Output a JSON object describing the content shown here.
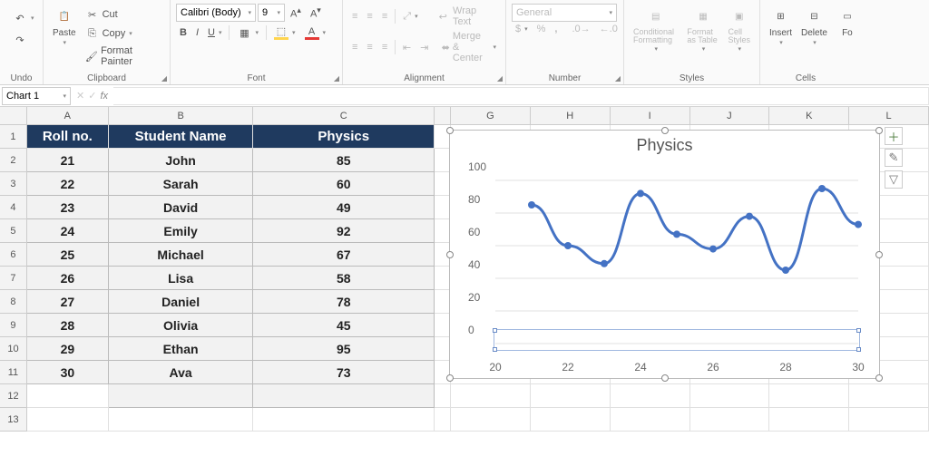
{
  "ribbon": {
    "undo": {
      "label": "Undo"
    },
    "clipboard": {
      "label": "Clipboard",
      "paste": "Paste",
      "cut": "Cut",
      "copy": "Copy",
      "format_painter": "Format Painter"
    },
    "font": {
      "label": "Font",
      "name": "Calibri (Body)",
      "size": "9"
    },
    "alignment": {
      "label": "Alignment",
      "wrap": "Wrap Text",
      "merge": "Merge & Center"
    },
    "number": {
      "label": "Number",
      "format": "General"
    },
    "styles": {
      "label": "Styles",
      "cond": "Conditional Formatting",
      "table": "Format as Table",
      "cell": "Cell Styles"
    },
    "cells": {
      "label": "Cells",
      "insert": "Insert",
      "delete": "Delete",
      "format": "Fo"
    }
  },
  "namebox": {
    "value": "Chart 1"
  },
  "columns": [
    "A",
    "B",
    "C",
    "",
    "G",
    "H",
    "I",
    "J",
    "K",
    "L"
  ],
  "table": {
    "headers": {
      "a": "Roll no.",
      "b": "Student Name",
      "c": "Physics"
    },
    "rows": [
      {
        "roll": "21",
        "name": "John",
        "score": "85"
      },
      {
        "roll": "22",
        "name": "Sarah",
        "score": "60"
      },
      {
        "roll": "23",
        "name": "David",
        "score": "49"
      },
      {
        "roll": "24",
        "name": "Emily",
        "score": "92"
      },
      {
        "roll": "25",
        "name": "Michael",
        "score": "67"
      },
      {
        "roll": "26",
        "name": "Lisa",
        "score": "58"
      },
      {
        "roll": "27",
        "name": "Daniel",
        "score": "78"
      },
      {
        "roll": "28",
        "name": "Olivia",
        "score": "45"
      },
      {
        "roll": "29",
        "name": "Ethan",
        "score": "95"
      },
      {
        "roll": "30",
        "name": "Ava",
        "score": "73"
      }
    ]
  },
  "chart_data": {
    "type": "line",
    "title": "Physics",
    "x": [
      21,
      22,
      23,
      24,
      25,
      26,
      27,
      28,
      29,
      30
    ],
    "values": [
      85,
      60,
      49,
      92,
      67,
      58,
      78,
      45,
      95,
      73
    ],
    "xlabel": "",
    "ylabel": "",
    "ylim": [
      0,
      100
    ],
    "xlim": [
      20,
      30
    ],
    "y_ticks": [
      0,
      20,
      40,
      60,
      80,
      100
    ],
    "x_ticks": [
      20,
      22,
      24,
      26,
      28,
      30
    ]
  }
}
